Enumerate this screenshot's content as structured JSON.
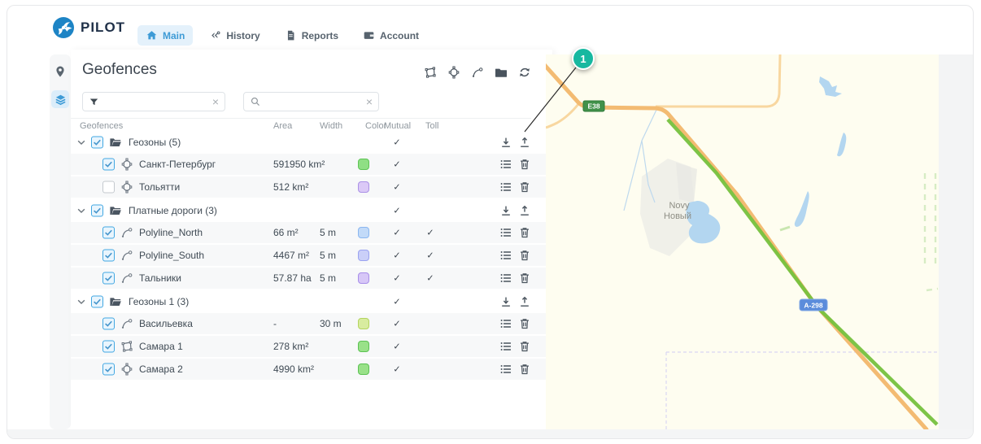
{
  "brand": {
    "name": "PILOT"
  },
  "nav": {
    "tabs": [
      {
        "label": "Main",
        "active": true
      },
      {
        "label": "History",
        "active": false
      },
      {
        "label": "Reports",
        "active": false
      },
      {
        "label": "Account",
        "active": false
      }
    ]
  },
  "sidebar": {
    "items": [
      {
        "icon": "location-pin"
      },
      {
        "icon": "layers",
        "active": true
      }
    ]
  },
  "panel": {
    "title": "Geofences",
    "toolbar": [
      "draw-polygon",
      "draw-circle",
      "draw-polyline",
      "folder",
      "refresh"
    ],
    "filter": {
      "value": "",
      "placeholder": ""
    },
    "search": {
      "value": "",
      "placeholder": ""
    },
    "table": {
      "headers": [
        "Geofences",
        "Area",
        "Width",
        "Color",
        "Mutual",
        "Toll"
      ],
      "rows": [
        {
          "kind": "group",
          "name": "Геозоны (5)",
          "area": "",
          "width": "",
          "mutual": "✓",
          "toll": "",
          "checked": true
        },
        {
          "kind": "circle",
          "name": "Санкт-Петербург",
          "area": "591950 km²",
          "width": "",
          "mutual": "✓",
          "toll": "",
          "checked": true,
          "swatch": "#8fdf84",
          "swatch_border": "#5ec455"
        },
        {
          "kind": "circle",
          "name": "Тольятти",
          "area": "512 km²",
          "width": "",
          "mutual": "✓",
          "toll": "",
          "checked": false,
          "swatch": "#dbc9f7",
          "swatch_border": "#ab91e6"
        },
        {
          "kind": "group",
          "name": "Платные дороги (3)",
          "area": "",
          "width": "",
          "mutual": "✓",
          "toll": "",
          "checked": true
        },
        {
          "kind": "polyline",
          "name": "Polyline_North",
          "area": "66 m²",
          "width": "5 m",
          "mutual": "✓",
          "toll": "✓",
          "checked": true,
          "swatch": "#c2daf8",
          "swatch_border": "#8ab6f0"
        },
        {
          "kind": "polyline",
          "name": "Polyline_South",
          "area": "4467 m²",
          "width": "5 m",
          "mutual": "✓",
          "toll": "✓",
          "checked": true,
          "swatch": "#cacff8",
          "swatch_border": "#9aa2f0"
        },
        {
          "kind": "polyline",
          "name": "Тальники",
          "area": "57.87 ha",
          "width": "5 m",
          "mutual": "✓",
          "toll": "✓",
          "checked": true,
          "swatch": "#d7c7f7",
          "swatch_border": "#a88ee9"
        },
        {
          "kind": "group",
          "name": "Геозоны 1 (3)",
          "area": "",
          "width": "",
          "mutual": "✓",
          "toll": "",
          "checked": true
        },
        {
          "kind": "polyline",
          "name": "Васильевка",
          "area": "-",
          "width": "30 m",
          "mutual": "✓",
          "toll": "",
          "checked": true,
          "swatch": "#d8ec9f",
          "swatch_border": "#b3d45e"
        },
        {
          "kind": "polygon",
          "name": "Самара 1",
          "area": "278 km²",
          "width": "",
          "mutual": "✓",
          "toll": "",
          "checked": true,
          "swatch": "#99e189",
          "swatch_border": "#5cc253"
        },
        {
          "kind": "circle",
          "name": "Самара 2",
          "area": "4990 km²",
          "width": "",
          "mutual": "✓",
          "toll": "",
          "checked": true,
          "swatch": "#99e189",
          "swatch_border": "#5cc253"
        }
      ]
    }
  },
  "map": {
    "badge_e38": "E38",
    "badge_a298": "A-298",
    "town_latin": "Novy",
    "town_cyrillic": "Новый"
  },
  "callout": {
    "number": "1"
  },
  "icons": {
    "clear": "×"
  },
  "colors": {
    "accent": "#3e9bd6",
    "callout": "#17b8a0",
    "road_badge_green": "#41914a",
    "road_badge_blue": "#5b8cdb",
    "road_orange": "#f3bb72",
    "route_green": "#76c13d",
    "map_background": "#fefdf0"
  }
}
